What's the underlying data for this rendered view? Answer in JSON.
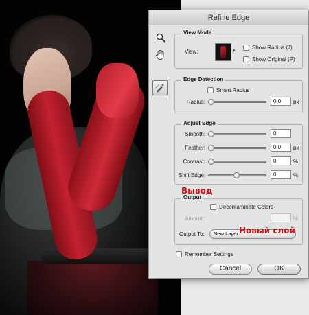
{
  "dialog": {
    "title": "Refine Edge"
  },
  "tools": {
    "zoom_icon": "zoom-icon",
    "hand_icon": "hand-icon",
    "brush_icon": "refine-radius-brush-icon"
  },
  "view_mode": {
    "legend": "View Mode",
    "view_label": "View:",
    "show_radius": "Show Radius (J)",
    "show_original": "Show Original (P)"
  },
  "edge_detection": {
    "legend": "Edge Detection",
    "smart_radius": "Smart Radius",
    "radius_label": "Radius:",
    "radius_value": "0.0",
    "radius_unit": "px",
    "radius_level": 0
  },
  "adjust_edge": {
    "legend": "Adjust Edge",
    "smooth_label": "Smooth:",
    "smooth_value": "0",
    "smooth_level": 0,
    "feather_label": "Feather:",
    "feather_value": "0.0",
    "feather_unit": "px",
    "feather_level": 0,
    "contrast_label": "Contrast:",
    "contrast_value": "0",
    "contrast_unit": "%",
    "contrast_level": 0,
    "shift_label": "Shift Edge:",
    "shift_value": "0",
    "shift_unit": "%",
    "shift_level": 0.5
  },
  "output": {
    "legend": "Output",
    "decontaminate": "Decontaminate Colors",
    "amount_label": "Amount:",
    "amount_unit": "%",
    "output_to_label": "Output To:",
    "output_to_value": "New Layer"
  },
  "remember_settings": "Remember Settings",
  "buttons": {
    "cancel": "Cancel",
    "ok": "OK"
  },
  "annotations": {
    "output_ru": "Вывод",
    "new_layer_ru": "Новый слой"
  },
  "colors": {
    "annotation": "#d40e12",
    "dialog_bg": "#e3e3e3"
  }
}
